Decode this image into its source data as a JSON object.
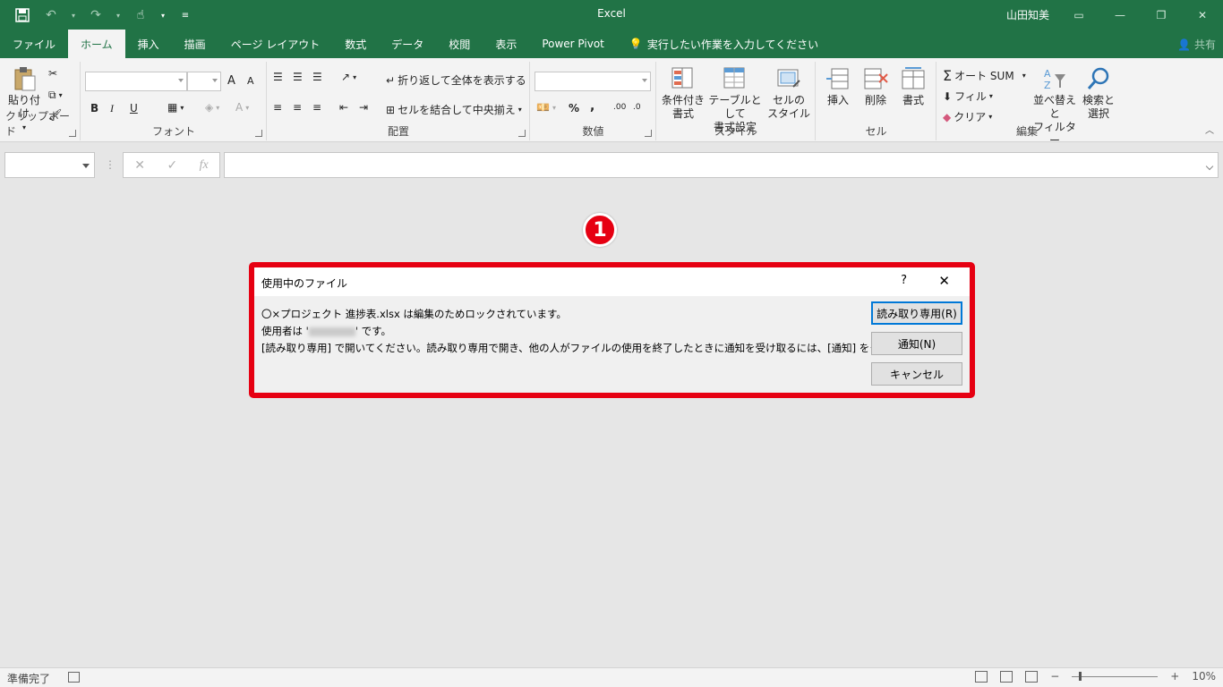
{
  "titlebar": {
    "app_title": "Excel",
    "user_name": "山田知美"
  },
  "tabs": [
    {
      "label": "ファイル"
    },
    {
      "label": "ホーム"
    },
    {
      "label": "挿入"
    },
    {
      "label": "描画"
    },
    {
      "label": "ページ レイアウト"
    },
    {
      "label": "数式"
    },
    {
      "label": "データ"
    },
    {
      "label": "校閲"
    },
    {
      "label": "表示"
    },
    {
      "label": "Power Pivot"
    },
    {
      "label": "実行したい作業を入力してください"
    }
  ],
  "share_label": "共有",
  "ribbon": {
    "clipboard": {
      "label": "クリップボード",
      "paste": "貼り付け"
    },
    "font": {
      "label": "フォント",
      "bold": "B",
      "italic": "I",
      "underline": "U",
      "grow": "A",
      "shrink": "A",
      "color_a": "A"
    },
    "alignment": {
      "label": "配置",
      "wrap_text": "折り返して全体を表示する",
      "merge_center": "セルを結合して中央揃え"
    },
    "number": {
      "label": "数値",
      "percent": "%",
      "comma": ","
    },
    "styles": {
      "label": "スタイル",
      "conditional_l1": "条件付き",
      "conditional_l2": "書式",
      "table_l1": "テーブルとして",
      "table_l2": "書式設定",
      "cell_l1": "セルの",
      "cell_l2": "スタイル"
    },
    "cells": {
      "label": "セル",
      "insert": "挿入",
      "delete": "削除",
      "format": "書式"
    },
    "editing": {
      "label": "編集",
      "autosum": "オート SUM",
      "fill": "フィル",
      "clear": "クリア",
      "sort_l1": "並べ替えと",
      "sort_l2": "フィルター",
      "find_l1": "検索と",
      "find_l2": "選択"
    }
  },
  "formula_bar": {
    "cancel": "✕",
    "enter": "✓",
    "fx": "fx"
  },
  "annotation": {
    "number": "1"
  },
  "dialog": {
    "title": "使用中のファイル",
    "help": "?",
    "line1": "〇×プロジェクト 進捗表.xlsx は編集のためロックされています。",
    "line2_prefix": "使用者は '",
    "line2_suffix": "' です。",
    "line3": "[読み取り専用] で開いてください。読み取り専用で開き、他の人がファイルの使用を終了したときに通知を受け取るには、[通知] をクリックします。",
    "btn_readonly": "読み取り専用(R)",
    "btn_notify": "通知(N)",
    "btn_cancel": "キャンセル"
  },
  "statusbar": {
    "ready": "準備完了",
    "zoom": "10%",
    "minus": "−",
    "plus": "+"
  },
  "colors": {
    "accent": "#217346",
    "highlight": "#e60012"
  }
}
